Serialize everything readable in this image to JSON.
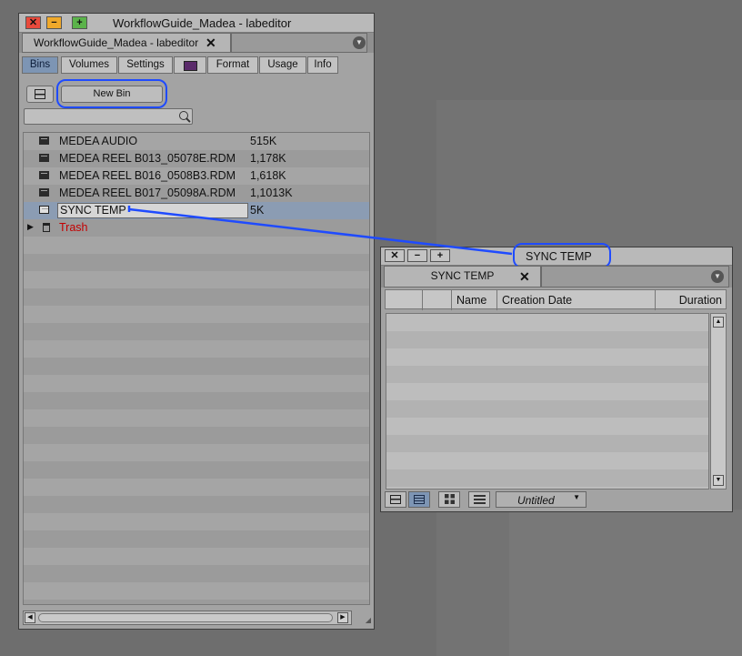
{
  "project_window": {
    "title": "WorkflowGuide_Madea - labeditor",
    "tab_title": "WorkflowGuide_Madea - labeditor",
    "tab_close": "✕",
    "buttons": {
      "close": "✕",
      "minimize": "−",
      "zoom": "+"
    },
    "tabs": [
      {
        "label": "Bins",
        "active": true
      },
      {
        "label": "Volumes",
        "active": false
      },
      {
        "label": "Settings",
        "active": false
      },
      {
        "label": "",
        "icon": "media-tool-icon",
        "active": false
      },
      {
        "label": "Format",
        "active": false
      },
      {
        "label": "Usage",
        "active": false
      },
      {
        "label": "Info",
        "active": false
      }
    ],
    "new_bin_label": "New Bin",
    "search_placeholder": "",
    "bins": [
      {
        "name": "MEDEA AUDIO",
        "size": "515K",
        "selected": false
      },
      {
        "name": "MEDEA REEL B013_05078E.RDM",
        "size": "1,178K",
        "selected": false
      },
      {
        "name": "MEDEA REEL B016_0508B3.RDM",
        "size": "1,618K",
        "selected": false
      },
      {
        "name": "MEDEA REEL B017_05098A.RDM",
        "size": "1,1013K",
        "selected": false
      },
      {
        "name": "SYNC TEMP",
        "size": "5K",
        "selected": true,
        "editing": true
      }
    ],
    "trash_label": "Trash",
    "trash_color": "#c40000"
  },
  "bin_window": {
    "title": "SYNC TEMP",
    "tab_title": "SYNC TEMP",
    "tab_close": "✕",
    "buttons": {
      "close": "✕",
      "minimize": "−",
      "zoom": "+"
    },
    "columns": [
      "",
      "",
      "Name",
      "Creation Date",
      "Duration"
    ],
    "view_label": "Untitled",
    "view_dropdown": "▼"
  },
  "colors": {
    "accent": "#7d95b4",
    "highlight": "#1f4bff",
    "close": "#e84a3c",
    "minimize": "#f0a92a",
    "zoom": "#5bb34a"
  }
}
